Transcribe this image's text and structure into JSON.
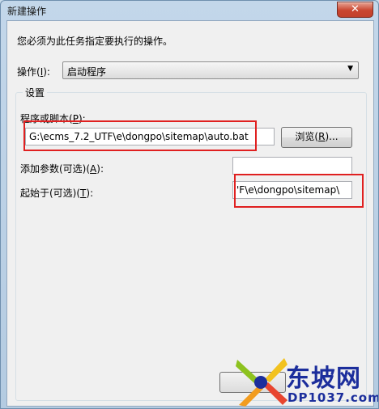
{
  "window": {
    "title": "新建操作",
    "close_glyph": "✕"
  },
  "instruction": "您必须为此任务指定要执行的操作。",
  "action": {
    "label_pre": "操作(",
    "label_key": "I",
    "label_post": "):",
    "value": "启动程序"
  },
  "settings": {
    "legend": "设置",
    "program": {
      "label_pre": "程序或脚本(",
      "label_key": "P",
      "label_post": "):",
      "value": "G:\\ecms_7.2_UTF\\e\\dongpo\\sitemap\\auto.bat"
    },
    "browse": {
      "label_pre": "浏览(",
      "label_key": "R",
      "label_post": ")..."
    },
    "arguments": {
      "label_pre": "添加参数(可选)(",
      "label_key": "A",
      "label_post": "):",
      "value": ""
    },
    "start_in": {
      "label_pre": "起始于(可选)(",
      "label_key": "T",
      "label_post": "):",
      "value": "'F\\e\\dongpo\\sitemap\\"
    }
  },
  "watermark": {
    "name": "东坡网",
    "url": "DP1037.com"
  },
  "colors": {
    "highlight": "#e02020",
    "watermark_blue": "#1c2e9c"
  }
}
